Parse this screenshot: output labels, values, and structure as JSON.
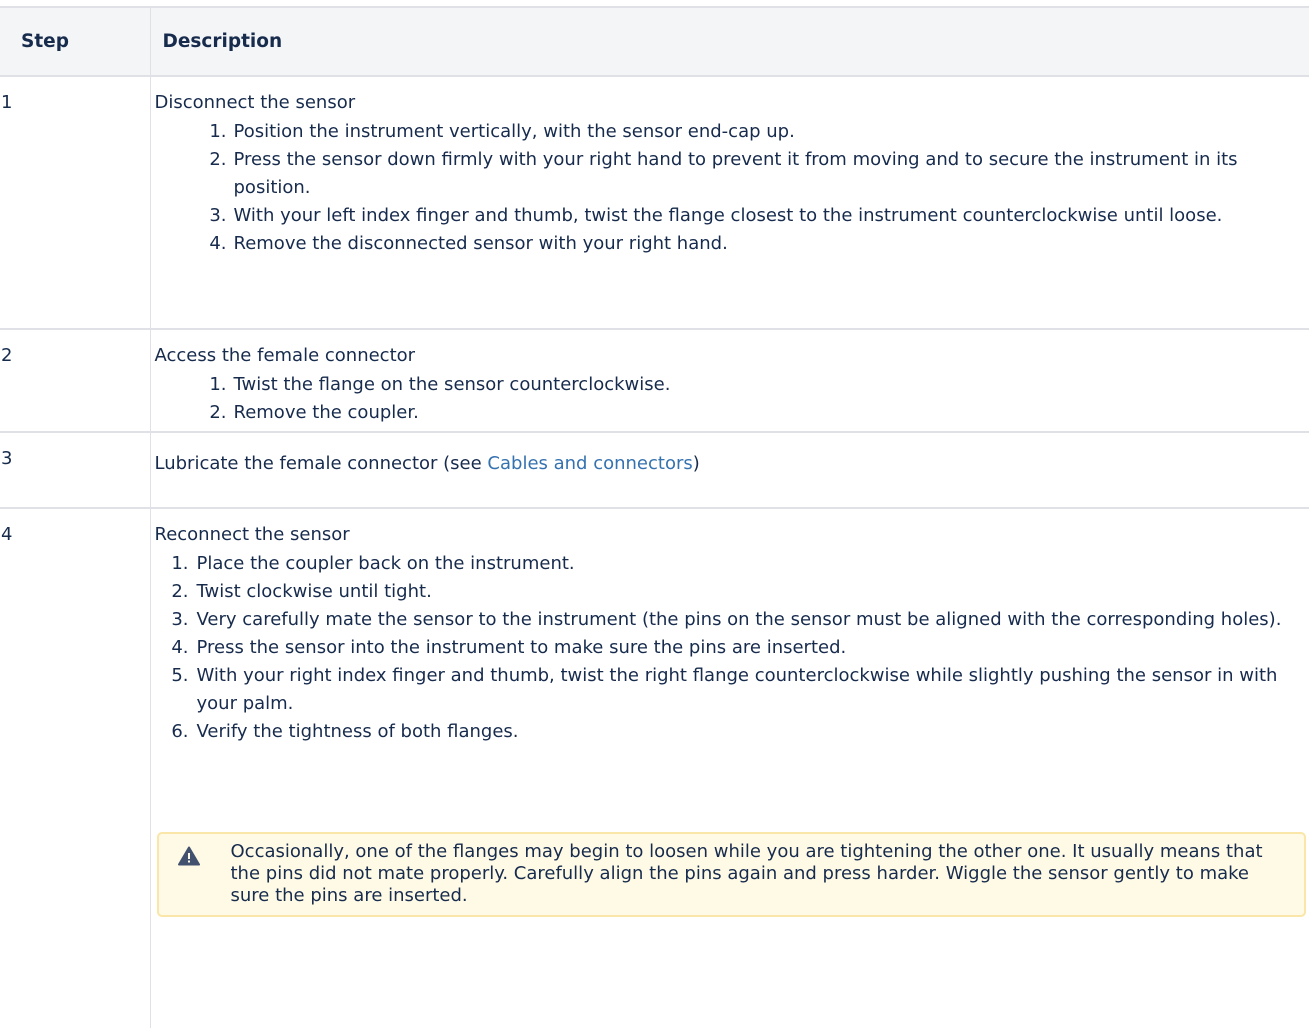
{
  "table": {
    "headers": [
      "Step",
      "Description"
    ],
    "rows": [
      {
        "step": "1",
        "title": "Disconnect the sensor",
        "items": [
          {
            "num": "1.",
            "text": "Position the instrument vertically, with the sensor end-cap up."
          },
          {
            "num": "2.",
            "text": "Press the sensor down firmly with your right hand to prevent it from moving and to secure the instrument in its position."
          },
          {
            "num": "3.",
            "text": "With your left index finger and thumb, twist the flange closest to the instrument counterclockwise until loose."
          },
          {
            "num": "4.",
            "text": "Remove the disconnected sensor with your right hand."
          }
        ]
      },
      {
        "step": "2",
        "title": "Access the female connector",
        "items": [
          {
            "num": "1.",
            "text": "Twist the flange on the sensor counterclockwise."
          },
          {
            "num": "2.",
            "text": "Remove the coupler."
          }
        ]
      },
      {
        "step": "3",
        "text_before": "Lubricate the female connector (see ",
        "link": "Cables and connectors",
        "text_after": ")"
      },
      {
        "step": "4",
        "title": "Reconnect the sensor",
        "items": [
          {
            "num": "1.",
            "text": "Place the coupler back on the instrument."
          },
          {
            "num": "2.",
            "text": "Twist clockwise until tight."
          },
          {
            "num": "3.",
            "text": "Very carefully mate the sensor to the instrument (the pins on the sensor must be aligned with the corresponding holes)."
          },
          {
            "num": "4.",
            "text": "Press the sensor into the instrument to make sure the pins are inserted."
          },
          {
            "num": "5.",
            "text": "With your right index finger and thumb, twist the right flange counterclockwise while slightly pushing the sensor in with your palm."
          },
          {
            "num": "6.",
            "text": "Verify the tightness of both flanges."
          }
        ],
        "warning": "Occasionally, one of the flanges may begin to loosen while you are tightening the other one. It usually means that the pins did not mate properly. Carefully align the pins again and press harder. Wiggle the sensor gently to make sure the pins are inserted."
      }
    ]
  },
  "colors": {
    "header_bg": "#f4f5f7",
    "link": "#3572b0",
    "warning_bg": "#fffae6",
    "warning_border": "#f9e6a8",
    "warning_icon": "#42526e"
  },
  "icons": {
    "warning": "warning-triangle-icon"
  }
}
